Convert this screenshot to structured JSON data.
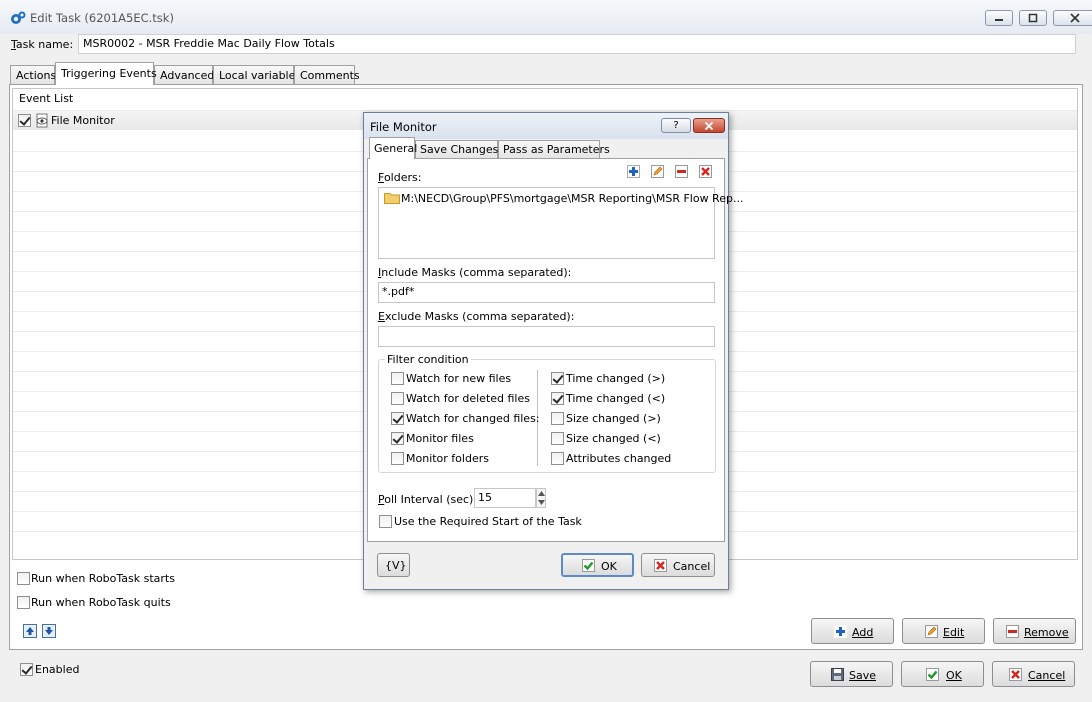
{
  "window": {
    "title": "Edit Task (6201A5EC.tsk)"
  },
  "task_name": {
    "label_prefix": "T",
    "label_rest": "ask name:",
    "value": "MSR0002 - MSR Freddie Mac Daily Flow Totals"
  },
  "tabs": [
    {
      "label": "Actions"
    },
    {
      "label": "Triggering Events"
    },
    {
      "label": "Advanced"
    },
    {
      "label": "Local variables"
    },
    {
      "label": "Comments"
    }
  ],
  "event_list": {
    "header": "Event List",
    "items": [
      {
        "label": "File Monitor",
        "checked": true
      }
    ]
  },
  "options": {
    "run_on_start": "Run when RoboTask starts",
    "run_on_quit": "Run when RoboTask quits"
  },
  "list_buttons": {
    "add": "Add",
    "edit": "Edit",
    "remove": "Remove"
  },
  "footer": {
    "enabled": "Enabled",
    "save": "Save",
    "ok": "OK",
    "cancel": "Cancel"
  },
  "dialog": {
    "title": "File Monitor",
    "help": "?",
    "tabs": [
      {
        "label": "General"
      },
      {
        "label": "Save Changes"
      },
      {
        "label": "Pass as Parameters"
      }
    ],
    "folders_label_prefix": "F",
    "folders_label_rest": "olders:",
    "folders": [
      "M:\\NECD\\Group\\PFS\\mortgage\\MSR Reporting\\MSR Flow Rep..."
    ],
    "include_label_prefix": "I",
    "include_label_rest": "nclude Masks (comma separated):",
    "include_value": "*.pdf*",
    "exclude_label_prefix": "E",
    "exclude_label_rest": "xclude Masks (comma separated):",
    "exclude_value": "",
    "filter_title": "Filter condition",
    "filters_left": [
      {
        "label": "Watch for new files",
        "checked": false
      },
      {
        "label": "Watch for deleted files",
        "checked": false
      },
      {
        "label": "Watch for changed files:",
        "checked": true
      },
      {
        "label": "Monitor files",
        "checked": true
      },
      {
        "label": "Monitor folders",
        "checked": false
      }
    ],
    "filters_right": [
      {
        "label": "Time changed (>)",
        "checked": true
      },
      {
        "label": "Time changed (<)",
        "checked": true
      },
      {
        "label": "Size changed (>)",
        "checked": false
      },
      {
        "label": "Size changed (<)",
        "checked": false
      },
      {
        "label": "Attributes changed",
        "checked": false
      }
    ],
    "poll_label_prefix": "P",
    "poll_label_rest": "oll Interval (sec):",
    "poll_value": "15",
    "use_required_start": "Use the Required Start of the Task",
    "var_button": "{V}",
    "ok": "OK",
    "cancel": "Cancel"
  }
}
